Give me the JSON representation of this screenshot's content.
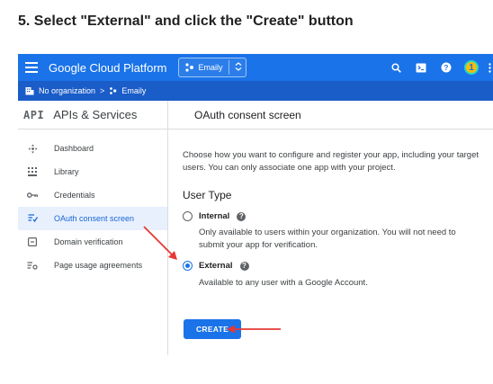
{
  "step_title": "5. Select \"External\" and click the \"Create\" button",
  "topbar": {
    "brand": "Google Cloud Platform",
    "project": "Emaily",
    "avatar_letter": "1"
  },
  "breadcrumb": {
    "org": "No organization",
    "separator": ">",
    "project": "Emaily"
  },
  "header": {
    "api_badge": "API",
    "section_title": "APIs & Services",
    "page_title": "OAuth consent screen"
  },
  "sidebar": {
    "items": [
      {
        "label": "Dashboard",
        "icon": "dashboard-icon"
      },
      {
        "label": "Library",
        "icon": "library-icon"
      },
      {
        "label": "Credentials",
        "icon": "key-icon"
      },
      {
        "label": "OAuth consent screen",
        "icon": "consent-icon",
        "active": true
      },
      {
        "label": "Domain verification",
        "icon": "domain-icon"
      },
      {
        "label": "Page usage agreements",
        "icon": "settings-list-icon"
      }
    ]
  },
  "main": {
    "description": "Choose how you want to configure and register your app, including your target users. You can only associate one app with your project.",
    "user_type_title": "User Type",
    "internal_label": "Internal",
    "internal_desc": "Only available to users within your organization. You will not need to submit your app for verification.",
    "external_label": "External",
    "external_desc": "Available to any user with a Google Account.",
    "help_glyph": "?",
    "create_label": "CREATE"
  },
  "colors": {
    "topbar": "#1a73e8",
    "crumbbar": "#1a5cc8",
    "arrow": "#e53935",
    "active_nav_bg": "#e8f0fe"
  }
}
